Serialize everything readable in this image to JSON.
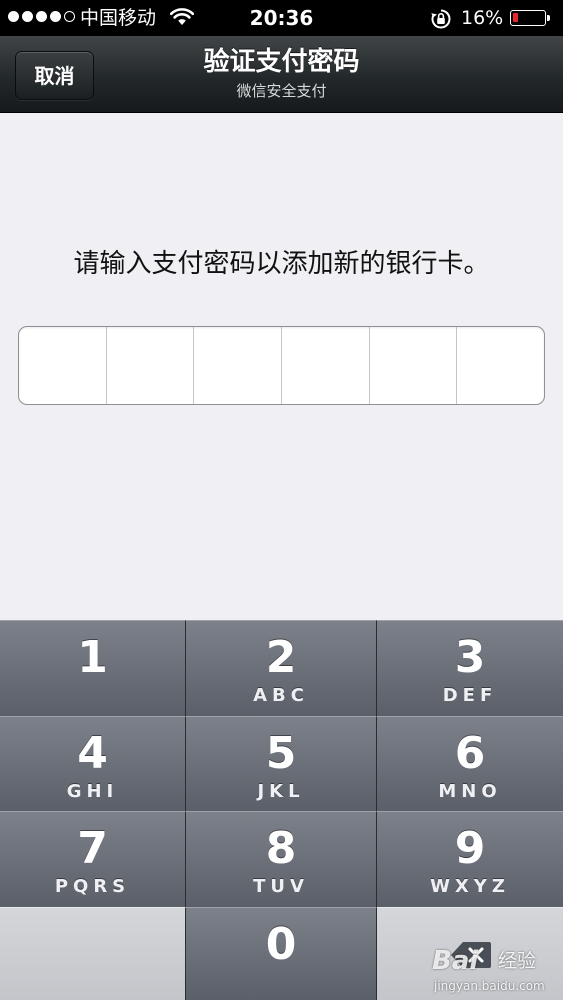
{
  "status_bar": {
    "carrier": "中国移动",
    "time": "20:36",
    "battery_percent": "16%",
    "battery_level": 0.16,
    "signal_bars_filled": 4,
    "signal_bars_total": 5
  },
  "nav": {
    "cancel_label": "取消",
    "title": "验证支付密码",
    "subtitle": "微信安全支付"
  },
  "main": {
    "prompt": "请输入支付密码以添加新的银行卡。",
    "pin_length": 6
  },
  "keypad": {
    "keys": [
      {
        "digit": "1",
        "letters": ""
      },
      {
        "digit": "2",
        "letters": "ABC"
      },
      {
        "digit": "3",
        "letters": "DEF"
      },
      {
        "digit": "4",
        "letters": "GHI"
      },
      {
        "digit": "5",
        "letters": "JKL"
      },
      {
        "digit": "6",
        "letters": "MNO"
      },
      {
        "digit": "7",
        "letters": "PQRS"
      },
      {
        "digit": "8",
        "letters": "TUV"
      },
      {
        "digit": "9",
        "letters": "WXYZ"
      },
      {
        "digit": "0",
        "letters": ""
      }
    ]
  },
  "watermark": {
    "logo": "Bai",
    "jingyan": "经验",
    "url": "jingyan.baidu.com"
  },
  "colors": {
    "battery_low": "#e8252b",
    "nav_bar": "#23282b",
    "page_background": "#efeff4",
    "key_dark": "#6b6f78",
    "key_light": "#c9cbd0"
  }
}
